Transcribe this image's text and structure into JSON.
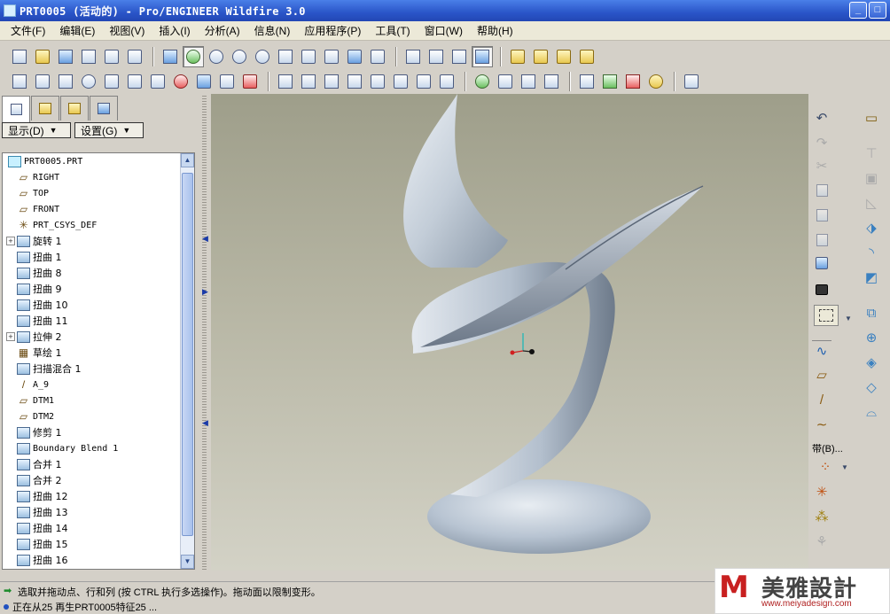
{
  "window": {
    "title": "PRT0005 (活动的) - Pro/ENGINEER Wildfire 3.0",
    "min_label": "_",
    "max_label": "□"
  },
  "menu": [
    "文件(F)",
    "编辑(E)",
    "视图(V)",
    "插入(I)",
    "分析(A)",
    "信息(N)",
    "应用程序(P)",
    "工具(T)",
    "窗口(W)",
    "帮助(H)"
  ],
  "panel": {
    "show_label": "显示(D)",
    "settings_label": "设置(G)"
  },
  "tree": [
    {
      "label": "PRT0005.PRT",
      "icon": "part-icon",
      "expandable": false,
      "root": true
    },
    {
      "label": "RIGHT",
      "icon": "datum-plane-icon",
      "expandable": false
    },
    {
      "label": "TOP",
      "icon": "datum-plane-icon",
      "expandable": false
    },
    {
      "label": "FRONT",
      "icon": "datum-plane-icon",
      "expandable": false
    },
    {
      "label": "PRT_CSYS_DEF",
      "icon": "csys-icon",
      "expandable": false
    },
    {
      "label": "旋转 1",
      "icon": "revolve-icon",
      "expandable": true
    },
    {
      "label": "扭曲 1",
      "icon": "warp-icon",
      "expandable": false
    },
    {
      "label": "扭曲 8",
      "icon": "warp-icon",
      "expandable": false
    },
    {
      "label": "扭曲 9",
      "icon": "warp-icon",
      "expandable": false
    },
    {
      "label": "扭曲 10",
      "icon": "warp-icon",
      "expandable": false
    },
    {
      "label": "扭曲 11",
      "icon": "warp-icon",
      "expandable": false
    },
    {
      "label": "拉伸 2",
      "icon": "extrude-icon",
      "expandable": true
    },
    {
      "label": "草绘 1",
      "icon": "sketch-icon",
      "expandable": false
    },
    {
      "label": "扫描混合 1",
      "icon": "swept-blend-icon",
      "expandable": false
    },
    {
      "label": "A_9",
      "icon": "axis-icon",
      "expandable": false
    },
    {
      "label": "DTM1",
      "icon": "datum-plane-icon",
      "expandable": false
    },
    {
      "label": "DTM2",
      "icon": "datum-plane-icon",
      "expandable": false
    },
    {
      "label": "修剪 1",
      "icon": "trim-icon",
      "expandable": false
    },
    {
      "label": "Boundary Blend 1",
      "icon": "boundary-blend-icon",
      "expandable": false
    },
    {
      "label": "合并 1",
      "icon": "merge-icon",
      "expandable": false
    },
    {
      "label": "合并 2",
      "icon": "merge-icon",
      "expandable": false
    },
    {
      "label": "扭曲 12",
      "icon": "warp-icon",
      "expandable": false
    },
    {
      "label": "扭曲 13",
      "icon": "warp-icon",
      "expandable": false
    },
    {
      "label": "扭曲 14",
      "icon": "warp-icon",
      "expandable": false
    },
    {
      "label": "扭曲 15",
      "icon": "warp-icon",
      "expandable": false
    },
    {
      "label": "扭曲 16",
      "icon": "warp-icon",
      "expandable": false
    }
  ],
  "right_toolbar": {
    "band_label": "带(B)..."
  },
  "status": {
    "line1": "选取并拖动点、行和列 (按 CTRL 执行多选操作)。拖动面以限制变形。",
    "line2": "正在从25 再生PRT0005特征25 ..."
  },
  "logo": {
    "mark": "M",
    "name": "美雅設計",
    "url": "www.meiyadesign.com"
  },
  "colors": {
    "title_bar": "#2a55c8",
    "surface": "#b9c4d2",
    "viewport_top": "#9e9e8a",
    "viewport_bottom": "#d3d2c6",
    "logo_red": "#c82020"
  }
}
